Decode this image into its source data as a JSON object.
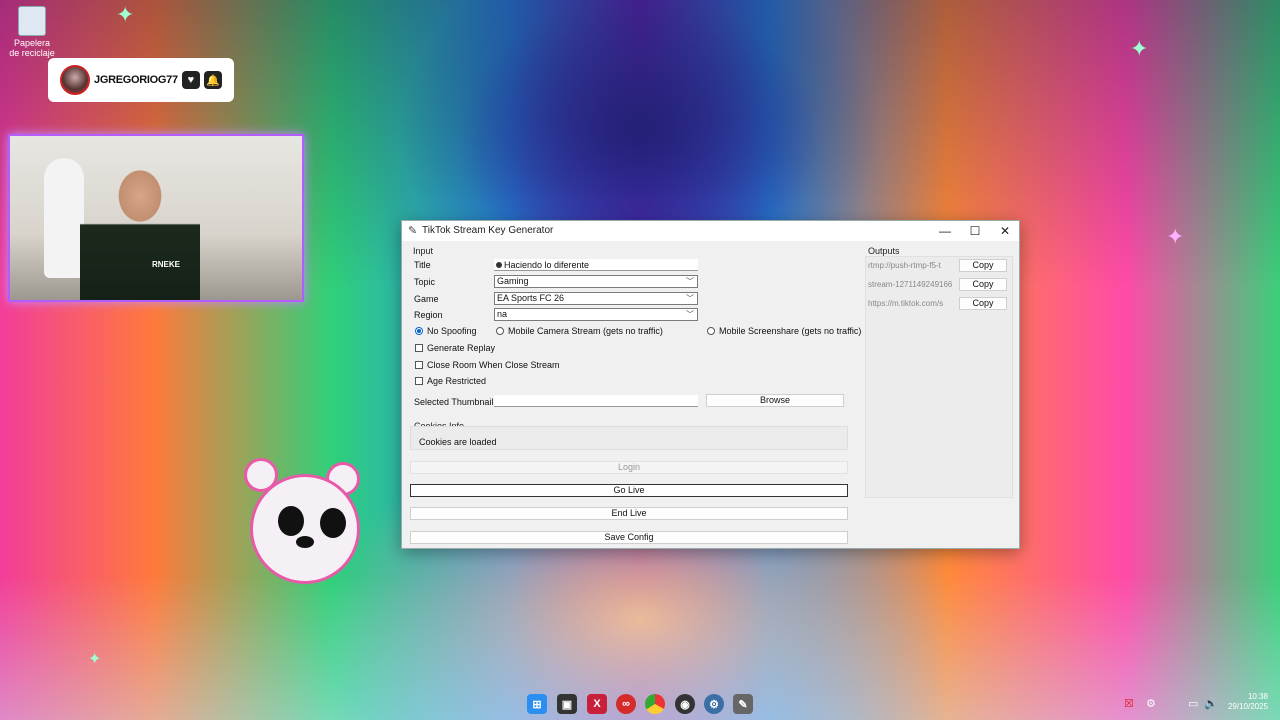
{
  "desktop": {
    "recycle_bin_label": "Papelera de reciclaje"
  },
  "overlay": {
    "streamer_name": "JGREGORIOG77",
    "webcam_shirt_text": "RNEKE"
  },
  "window": {
    "title": "TikTok Stream Key Generator",
    "input_section_label": "Input",
    "fields": {
      "title_label": "Title",
      "title_value": "Haciendo lo diferente",
      "topic_label": "Topic",
      "topic_value": "Gaming",
      "game_label": "Game",
      "game_value": "EA Sports FC 26",
      "region_label": "Region",
      "region_value": "na"
    },
    "radios": [
      {
        "label": "No Spoofing",
        "selected": true
      },
      {
        "label": "Mobile Camera Stream (gets no traffic)",
        "selected": false
      },
      {
        "label": "Mobile Screenshare (gets no traffic)",
        "selected": false
      }
    ],
    "checkboxes": [
      {
        "label": "Generate Replay",
        "checked": false
      },
      {
        "label": "Close Room When Close Stream",
        "checked": false
      },
      {
        "label": "Age Restricted",
        "checked": false
      }
    ],
    "thumbnail_label": "Selected Thumbnail:",
    "thumbnail_value": "",
    "browse_label": "Browse",
    "cookies_section_label": "Cookies Info",
    "cookies_status": "Cookies are loaded",
    "login_label": "Login",
    "go_live_label": "Go Live",
    "end_live_label": "End Live",
    "save_config_label": "Save Config",
    "outputs_label": "Outputs",
    "outputs": [
      {
        "value": "rtmp://push-rtmp-f5-t",
        "copy_label": "Copy"
      },
      {
        "value": "stream-1271149249166",
        "copy_label": "Copy"
      },
      {
        "value": "https://m.tiktok.com/s",
        "copy_label": "Copy"
      }
    ]
  },
  "taskbar": {
    "time": "10:38",
    "date": "29/10/2025"
  },
  "colors": {
    "accent": "#0a64c8",
    "webcam_border": "#b35cff",
    "window_bg": "#f0f0f0"
  }
}
